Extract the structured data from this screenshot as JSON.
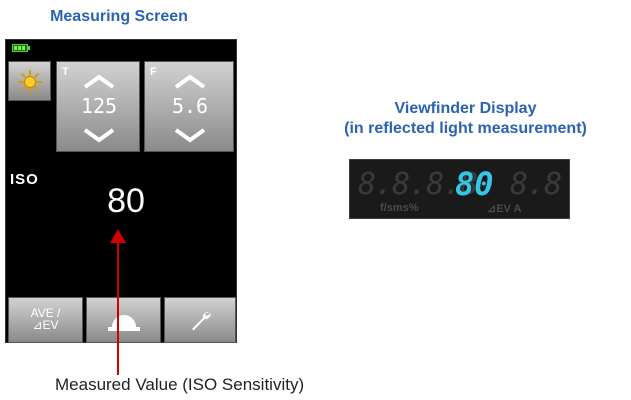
{
  "titles": {
    "measuring_screen": "Measuring Screen",
    "viewfinder_line1": "Viewfinder Display",
    "viewfinder_line2": "(in reflected light measurement)"
  },
  "screen": {
    "shutter": {
      "letter": "T",
      "value": "125"
    },
    "aperture": {
      "letter": "F",
      "value": "5.6"
    },
    "iso_label": "ISO",
    "iso_value": "80",
    "ave_label_line1": "AVE /",
    "ave_label_line2": "⊿EV"
  },
  "viewfinder": {
    "dim_digits_left": "8.8.8.8",
    "iso_value": "80",
    "dim_digits_right": "8.8",
    "unit_label": "f/sms%",
    "ev_label": "⊿EV A"
  },
  "caption": "Measured Value (ISO Sensitivity)",
  "icons": [
    "battery-icon",
    "sun-icon",
    "chevron-up-icon",
    "chevron-down-icon",
    "dome-icon",
    "wrench-icon"
  ],
  "colors": {
    "accent_blue": "#2b63b3",
    "pointer_red": "#d00000",
    "lcd_cyan": "#33c6e6"
  }
}
